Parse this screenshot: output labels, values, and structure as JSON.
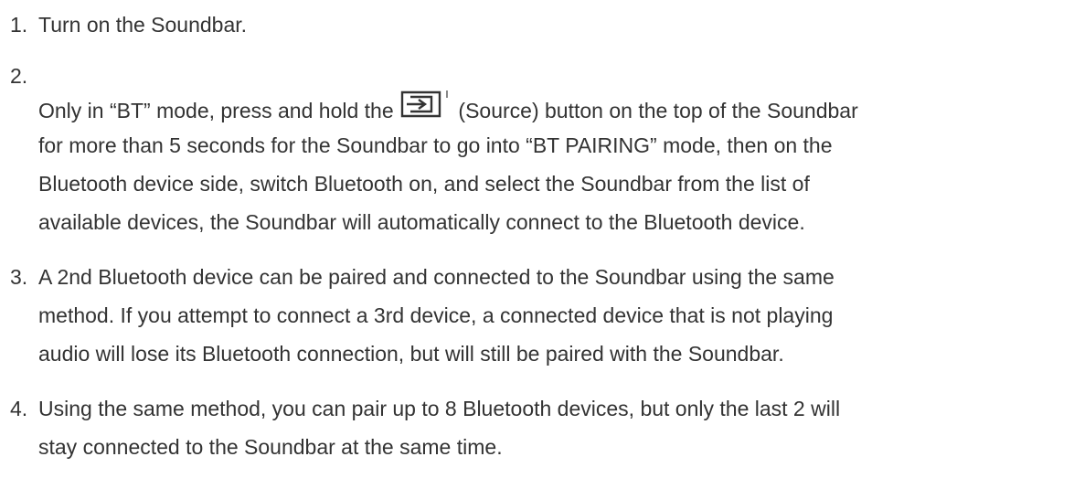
{
  "steps": [
    {
      "number": "1.",
      "lines": [
        "Turn on the Soundbar."
      ]
    },
    {
      "number": "2.",
      "line1_before_icon": "Only in “BT” mode, press and hold the",
      "icon": "source-button-icon",
      "line1_after_icon": "(Source) button on the top of the Soundbar",
      "lines": [
        "for more than 5 seconds for the Soundbar to go into “BT PAIRING” mode, then on the",
        "Bluetooth device side, switch Bluetooth on, and select the Soundbar from the list of",
        "available devices, the Soundbar will automatically connect to the Bluetooth device."
      ]
    },
    {
      "number": "3.",
      "lines": [
        "A 2nd Bluetooth device can be paired and connected to the Soundbar using the same",
        "method. If you attempt to connect a 3rd device, a connected device that is not playing",
        "audio will lose its Bluetooth connection, but will still be paired with the Soundbar."
      ]
    },
    {
      "number": "4.",
      "lines": [
        "Using the same method, you can pair up to 8 Bluetooth devices, but only the last 2 will",
        "stay connected to the Soundbar at the same time."
      ]
    }
  ]
}
